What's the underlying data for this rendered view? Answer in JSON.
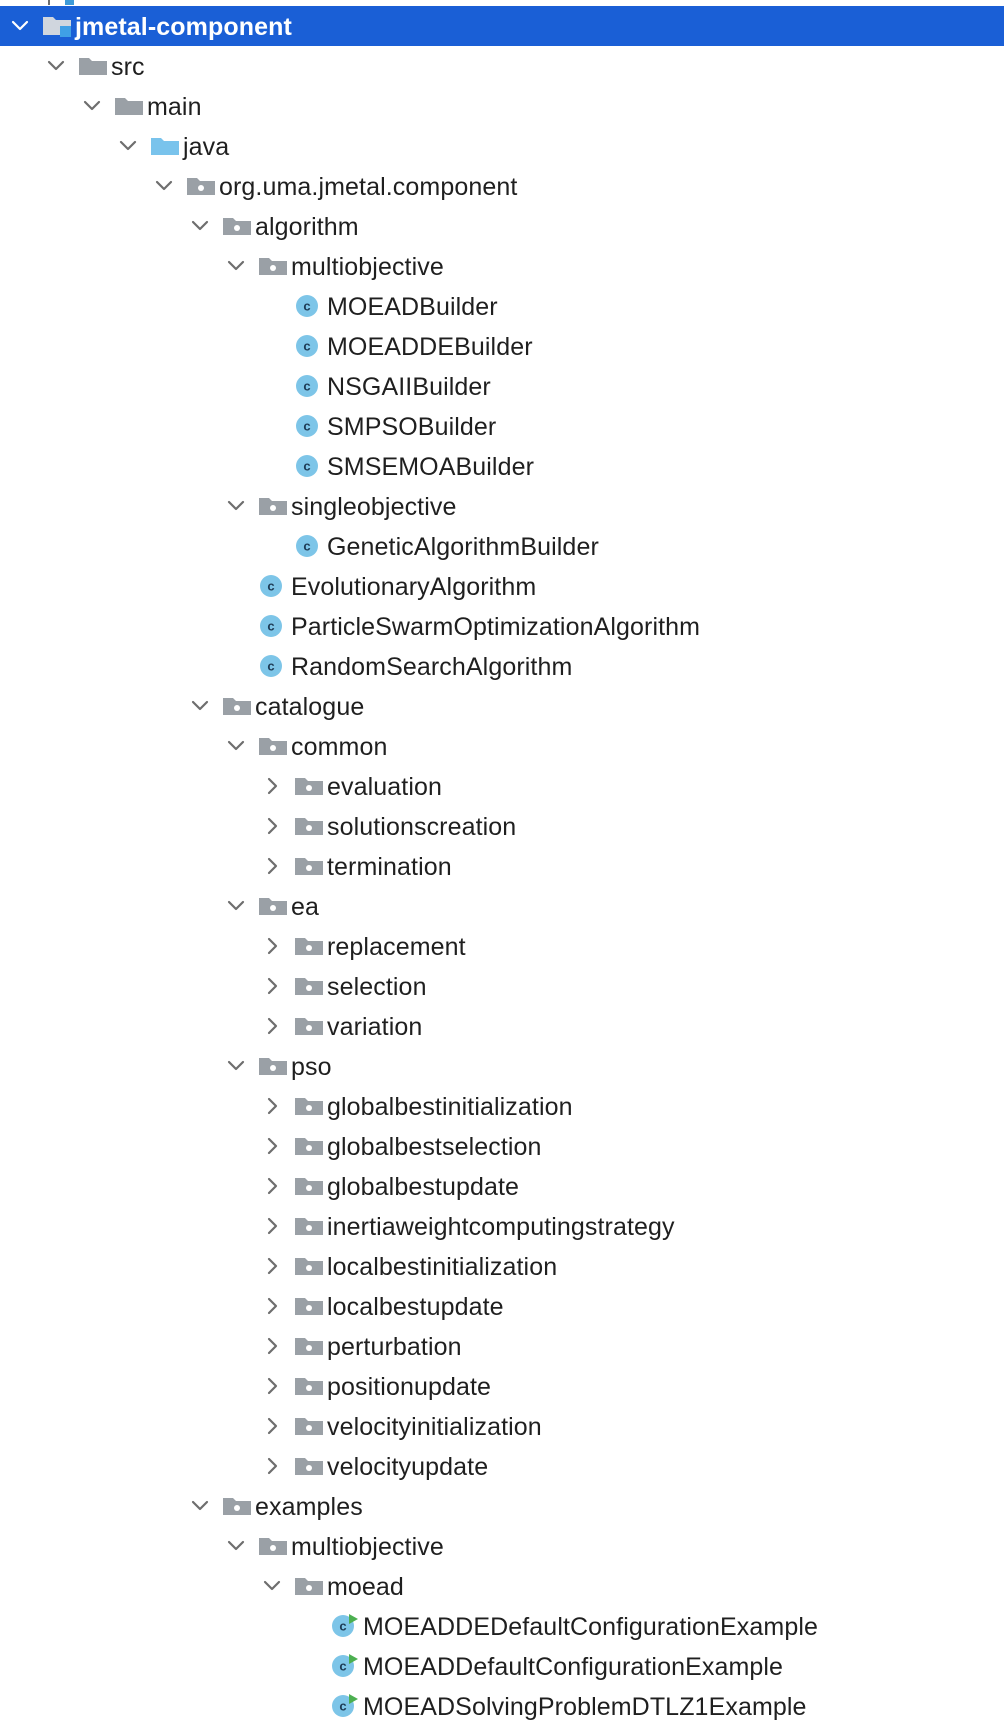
{
  "colors": {
    "selection": "#1a5fd6",
    "folder_gray": "#9aa0a6",
    "source_folder": "#79c3ec",
    "class_icon": "#7dc5e8",
    "run_marker": "#4caf50"
  },
  "tree": [
    {
      "name": "jmetal-component",
      "level": 0,
      "state": "expanded",
      "icon": "module-folder-icon",
      "selected": true
    },
    {
      "name": "src",
      "level": 1,
      "state": "expanded",
      "icon": "folder-icon"
    },
    {
      "name": "main",
      "level": 2,
      "state": "expanded",
      "icon": "folder-icon"
    },
    {
      "name": "java",
      "level": 3,
      "state": "expanded",
      "icon": "source-root-folder-icon"
    },
    {
      "name": "org.uma.jmetal.component",
      "level": 4,
      "state": "expanded",
      "icon": "package-icon"
    },
    {
      "name": "algorithm",
      "level": 5,
      "state": "expanded",
      "icon": "package-icon"
    },
    {
      "name": "multiobjective",
      "level": 6,
      "state": "expanded",
      "icon": "package-icon"
    },
    {
      "name": "MOEADBuilder",
      "level": 7,
      "state": "leaf",
      "icon": "class-icon"
    },
    {
      "name": "MOEADDEBuilder",
      "level": 7,
      "state": "leaf",
      "icon": "class-icon"
    },
    {
      "name": "NSGAIIBuilder",
      "level": 7,
      "state": "leaf",
      "icon": "class-icon"
    },
    {
      "name": "SMPSOBuilder",
      "level": 7,
      "state": "leaf",
      "icon": "class-icon"
    },
    {
      "name": "SMSEMOABuilder",
      "level": 7,
      "state": "leaf",
      "icon": "class-icon"
    },
    {
      "name": "singleobjective",
      "level": 6,
      "state": "expanded",
      "icon": "package-icon"
    },
    {
      "name": "GeneticAlgorithmBuilder",
      "level": 7,
      "state": "leaf",
      "icon": "class-icon"
    },
    {
      "name": "EvolutionaryAlgorithm",
      "level": 6,
      "state": "leaf",
      "icon": "class-icon"
    },
    {
      "name": "ParticleSwarmOptimizationAlgorithm",
      "level": 6,
      "state": "leaf",
      "icon": "class-icon"
    },
    {
      "name": "RandomSearchAlgorithm",
      "level": 6,
      "state": "leaf",
      "icon": "class-icon"
    },
    {
      "name": "catalogue",
      "level": 5,
      "state": "expanded",
      "icon": "package-icon"
    },
    {
      "name": "common",
      "level": 6,
      "state": "expanded",
      "icon": "package-icon"
    },
    {
      "name": "evaluation",
      "level": 7,
      "state": "collapsed",
      "icon": "package-icon"
    },
    {
      "name": "solutionscreation",
      "level": 7,
      "state": "collapsed",
      "icon": "package-icon"
    },
    {
      "name": "termination",
      "level": 7,
      "state": "collapsed",
      "icon": "package-icon"
    },
    {
      "name": "ea",
      "level": 6,
      "state": "expanded",
      "icon": "package-icon"
    },
    {
      "name": "replacement",
      "level": 7,
      "state": "collapsed",
      "icon": "package-icon"
    },
    {
      "name": "selection",
      "level": 7,
      "state": "collapsed",
      "icon": "package-icon"
    },
    {
      "name": "variation",
      "level": 7,
      "state": "collapsed",
      "icon": "package-icon"
    },
    {
      "name": "pso",
      "level": 6,
      "state": "expanded",
      "icon": "package-icon"
    },
    {
      "name": "globalbestinitialization",
      "level": 7,
      "state": "collapsed",
      "icon": "package-icon"
    },
    {
      "name": "globalbestselection",
      "level": 7,
      "state": "collapsed",
      "icon": "package-icon"
    },
    {
      "name": "globalbestupdate",
      "level": 7,
      "state": "collapsed",
      "icon": "package-icon"
    },
    {
      "name": "inertiaweightcomputingstrategy",
      "level": 7,
      "state": "collapsed",
      "icon": "package-icon"
    },
    {
      "name": "localbestinitialization",
      "level": 7,
      "state": "collapsed",
      "icon": "package-icon"
    },
    {
      "name": "localbestupdate",
      "level": 7,
      "state": "collapsed",
      "icon": "package-icon"
    },
    {
      "name": "perturbation",
      "level": 7,
      "state": "collapsed",
      "icon": "package-icon"
    },
    {
      "name": "positionupdate",
      "level": 7,
      "state": "collapsed",
      "icon": "package-icon"
    },
    {
      "name": "velocityinitialization",
      "level": 7,
      "state": "collapsed",
      "icon": "package-icon"
    },
    {
      "name": "velocityupdate",
      "level": 7,
      "state": "collapsed",
      "icon": "package-icon"
    },
    {
      "name": "examples",
      "level": 5,
      "state": "expanded",
      "icon": "package-icon"
    },
    {
      "name": "multiobjective",
      "level": 6,
      "state": "expanded",
      "icon": "package-icon"
    },
    {
      "name": "moead",
      "level": 7,
      "state": "expanded",
      "icon": "package-icon"
    },
    {
      "name": "MOEADDEDefaultConfigurationExample",
      "level": 8,
      "state": "leaf",
      "icon": "runnable-class-icon"
    },
    {
      "name": "MOEADDefaultConfigurationExample",
      "level": 8,
      "state": "leaf",
      "icon": "runnable-class-icon"
    },
    {
      "name": "MOEADSolvingProblemDTLZ1Example",
      "level": 8,
      "state": "leaf",
      "icon": "runnable-class-icon"
    }
  ]
}
